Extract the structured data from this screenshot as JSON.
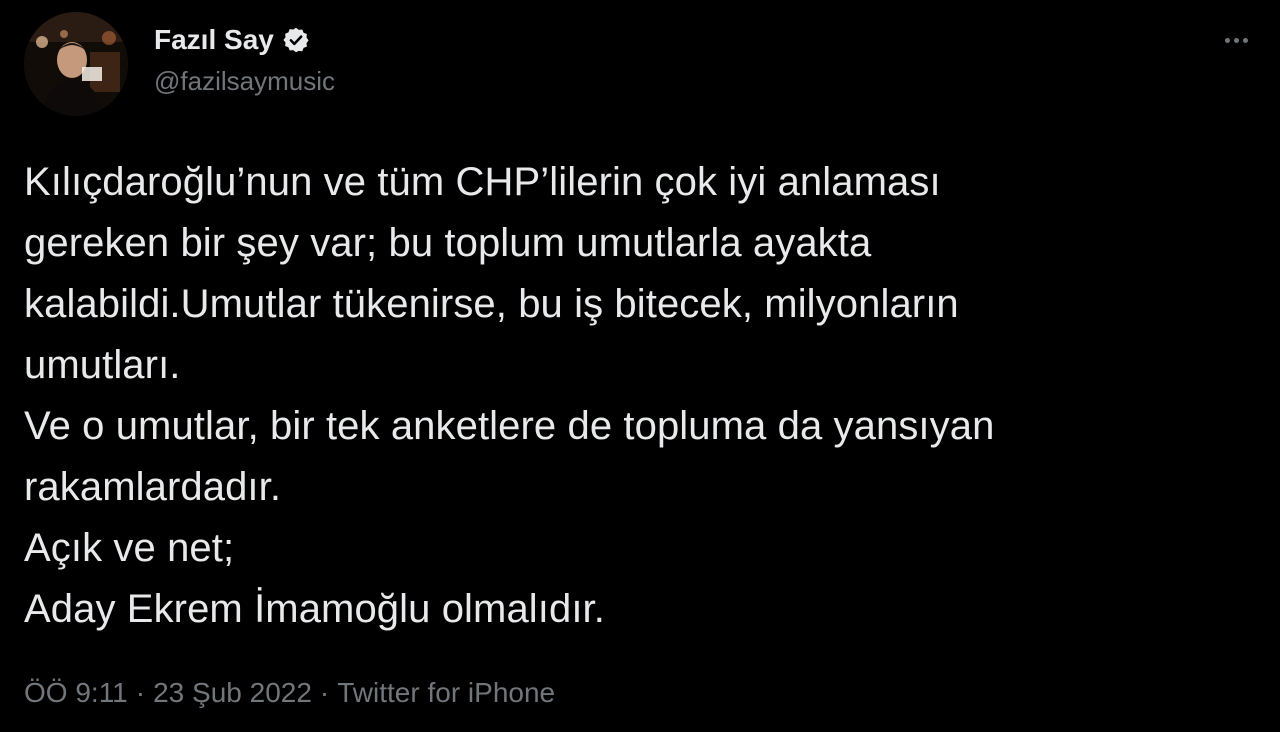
{
  "author": {
    "display_name": "Fazıl Say",
    "handle": "@fazilsaymusic",
    "verified_icon": "verified-badge-icon",
    "avatar_icon": "profile-photo"
  },
  "tweet": {
    "lines": [
      "Kılıçdaroğlu’nun ve tüm CHP’lilerin çok iyi anlaması",
      "gereken bir şey var; bu toplum umutlarla ayakta",
      "kalabildi.Umutlar tükenirse, bu iş bitecek, milyonların",
      "umutları.",
      "Ve o umutlar, bir tek anketlere de topluma da yansıyan",
      "rakamlardadır.",
      "Açık ve net;",
      "Aday Ekrem İmamoğlu olmalıdır."
    ]
  },
  "meta": {
    "time": "ÖÖ 9:11",
    "separator": "·",
    "date": "23 Şub 2022",
    "source": "Twitter for iPhone"
  },
  "colors": {
    "background": "#000000",
    "text_primary": "#e7e9ea",
    "text_secondary": "#71767b",
    "verified_badge": "#e7e9ea"
  },
  "icons": {
    "more": "more-options-icon"
  }
}
